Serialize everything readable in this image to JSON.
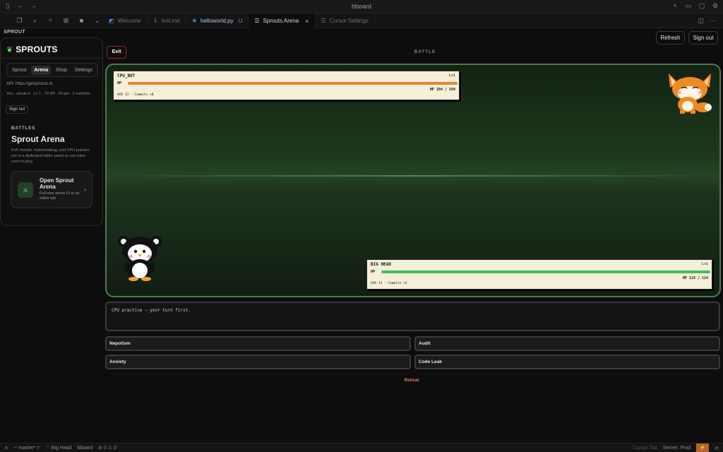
{
  "window": {
    "title": "bboard"
  },
  "tabs": [
    {
      "label": "Welcome",
      "icon": "cursor-logo-icon"
    },
    {
      "label": "test.md",
      "icon": "markdown-icon"
    },
    {
      "label": "helloworld.py",
      "icon": "python-icon",
      "status": "U"
    },
    {
      "label": "Sprouts Arena",
      "icon": "panel-icon",
      "close": "×"
    },
    {
      "label": "Cursor Settings",
      "icon": "settings-icon"
    }
  ],
  "sidebar": {
    "section_title": "SPROUT",
    "brand": "SPROUTS",
    "nav": [
      "Sprout",
      "Arena",
      "Shop",
      "Settings"
    ],
    "active_nav": "Arena",
    "api": "API: https://getsprouts.io",
    "stats": "You · streak 0 · Lv 1 · 70 XP · 20 pts · 2 commits",
    "sign_out": "Sign out",
    "kicker": "BATTLES",
    "title": "Sprout Arena",
    "description": "PvP, friends, matchmaking, and CPU practice run in a dedicated editor panel so you have room to play.",
    "card": {
      "title": "Open Sprout Arena",
      "subtitle": "Full-size arena UI in an editor tab"
    }
  },
  "main": {
    "exit": "Exit",
    "heading": "BATTLE",
    "refresh": "Refresh",
    "sign_out": "Sign out",
    "enemy": {
      "name": "CPU_BOT",
      "level": "Lv1",
      "hp_label": "HP",
      "hp_text": "HP 104 / 104",
      "hp_current": 104,
      "hp_max": 104,
      "meta": "ACK 13 · Commits +0"
    },
    "player": {
      "name": "BIG HEAD",
      "level": "Lv1",
      "hp_label": "HP",
      "hp_text": "HP 114 / 114",
      "hp_current": 114,
      "hp_max": 114,
      "meta": "ACK 13 · Commits +2"
    },
    "log": "CPU practice — your turn first.",
    "moves": [
      "Nepotism",
      "Audit",
      "Anxiety",
      "Code Leak"
    ],
    "retreat": "Retreat"
  },
  "statusbar": {
    "branch": "master*",
    "profile": "Big Head",
    "workspace": "bboard",
    "problems": "0 ⚠ 0",
    "cursor_tab": "Cursor Tab",
    "server": "Server: Prod"
  },
  "colors": {
    "accent_green": "#6bd36b",
    "enemy_hp": "#e8843a",
    "player_hp": "#38c45c",
    "exit_border": "#8a2b2b",
    "retreat": "#e87878"
  }
}
